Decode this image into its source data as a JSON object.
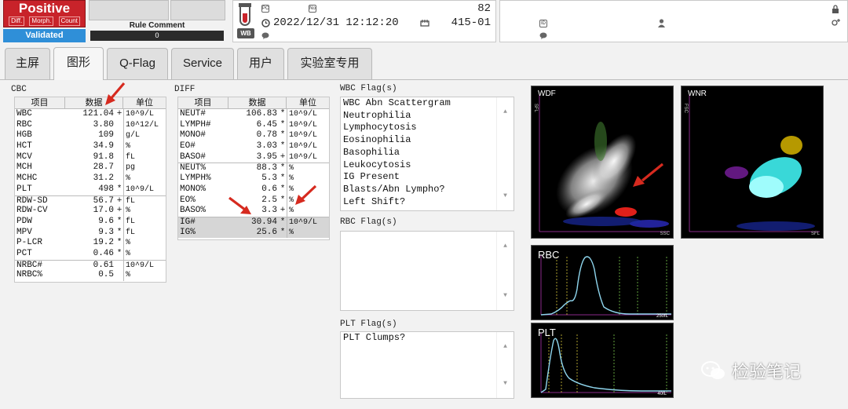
{
  "status": {
    "result": "Positive",
    "sub_flags": [
      "Diff.",
      "Morph.",
      "Count"
    ],
    "validated": "Validated",
    "rule_comment_label": "Rule Comment",
    "rule_comment_value": "0"
  },
  "sample": {
    "tube_type": "WB",
    "pc_icon_label": "PC",
    "no_icon_label": "No",
    "number": "82",
    "datetime": "2022/12/31 12:12:20",
    "rack_position": "415-01"
  },
  "patient": {
    "id_icon_label": "ID"
  },
  "tabs": [
    {
      "label": "主屏",
      "active": false
    },
    {
      "label": "图形",
      "active": true
    },
    {
      "label": "Q-Flag",
      "active": false
    },
    {
      "label": "Service",
      "active": false
    },
    {
      "label": "用户",
      "active": false
    },
    {
      "label": "实验室专用",
      "active": false
    }
  ],
  "cbc": {
    "title": "CBC",
    "headers": [
      "项目",
      "数据",
      "单位"
    ],
    "rows": [
      {
        "name": "WBC",
        "value": "121.04",
        "flag": "+",
        "unit": "10^9/L",
        "sep": false
      },
      {
        "name": "RBC",
        "value": "3.80",
        "flag": "",
        "unit": "10^12/L",
        "sep": false
      },
      {
        "name": "HGB",
        "value": "109",
        "flag": "",
        "unit": "g/L",
        "sep": false
      },
      {
        "name": "HCT",
        "value": "34.9",
        "flag": "",
        "unit": "%",
        "sep": false
      },
      {
        "name": "MCV",
        "value": "91.8",
        "flag": "",
        "unit": "fL",
        "sep": false
      },
      {
        "name": "MCH",
        "value": "28.7",
        "flag": "",
        "unit": "pg",
        "sep": false
      },
      {
        "name": "MCHC",
        "value": "31.2",
        "flag": "",
        "unit": "%",
        "sep": false
      },
      {
        "name": "PLT",
        "value": "498",
        "flag": "*",
        "unit": "10^9/L",
        "sep": false
      },
      {
        "name": "RDW-SD",
        "value": "56.7",
        "flag": "+",
        "unit": "fL",
        "sep": true
      },
      {
        "name": "RDW-CV",
        "value": "17.0",
        "flag": "+",
        "unit": "%",
        "sep": false
      },
      {
        "name": "PDW",
        "value": "9.6",
        "flag": "*",
        "unit": "fL",
        "sep": false
      },
      {
        "name": "MPV",
        "value": "9.3",
        "flag": "*",
        "unit": "fL",
        "sep": false
      },
      {
        "name": "P-LCR",
        "value": "19.2",
        "flag": "*",
        "unit": "%",
        "sep": false
      },
      {
        "name": "PCT",
        "value": "0.46",
        "flag": "*",
        "unit": "%",
        "sep": false
      },
      {
        "name": "NRBC#",
        "value": "0.61",
        "flag": "",
        "unit": "10^9/L",
        "sep": true
      },
      {
        "name": "NRBC%",
        "value": "0.5",
        "flag": "",
        "unit": "%",
        "sep": false
      }
    ]
  },
  "diff": {
    "title": "DIFF",
    "headers": [
      "项目",
      "数据",
      "单位"
    ],
    "rows": [
      {
        "name": "NEUT#",
        "value": "106.83",
        "flag": "*",
        "unit": "10^9/L",
        "sep": false,
        "hl": false
      },
      {
        "name": "LYMPH#",
        "value": "6.45",
        "flag": "*",
        "unit": "10^9/L",
        "sep": false,
        "hl": false
      },
      {
        "name": "MONO#",
        "value": "0.78",
        "flag": "*",
        "unit": "10^9/L",
        "sep": false,
        "hl": false
      },
      {
        "name": "EO#",
        "value": "3.03",
        "flag": "*",
        "unit": "10^9/L",
        "sep": false,
        "hl": false
      },
      {
        "name": "BASO#",
        "value": "3.95",
        "flag": "+",
        "unit": "10^9/L",
        "sep": false,
        "hl": false
      },
      {
        "name": "NEUT%",
        "value": "88.3",
        "flag": "*",
        "unit": "%",
        "sep": true,
        "hl": false
      },
      {
        "name": "LYMPH%",
        "value": "5.3",
        "flag": "*",
        "unit": "%",
        "sep": false,
        "hl": false
      },
      {
        "name": "MONO%",
        "value": "0.6",
        "flag": "*",
        "unit": "%",
        "sep": false,
        "hl": false
      },
      {
        "name": "EO%",
        "value": "2.5",
        "flag": "*",
        "unit": "%",
        "sep": false,
        "hl": false
      },
      {
        "name": "BASO%",
        "value": "3.3",
        "flag": "+",
        "unit": "%",
        "sep": false,
        "hl": false
      },
      {
        "name": "IG#",
        "value": "30.94",
        "flag": "*",
        "unit": "10^9/L",
        "sep": true,
        "hl": true
      },
      {
        "name": "IG%",
        "value": "25.6",
        "flag": "*",
        "unit": "%",
        "sep": false,
        "hl": true
      }
    ]
  },
  "wbc_flags": {
    "title": "WBC Flag(s)",
    "items": [
      "WBC Abn Scattergram",
      "Neutrophilia",
      "Lymphocytosis",
      "Eosinophilia",
      "Basophilia",
      "Leukocytosis",
      "IG Present",
      "Blasts/Abn Lympho?",
      "Left Shift?"
    ]
  },
  "rbc_flags": {
    "title": "RBC Flag(s)",
    "items": []
  },
  "plt_flags": {
    "title": "PLT Flag(s)",
    "items": [
      "PLT Clumps?"
    ]
  },
  "plots": {
    "wdf": {
      "label": "WDF",
      "y_axis": "SFL",
      "x_axis": "SSC"
    },
    "wnr": {
      "label": "WNR",
      "y_axis": "FSC",
      "x_axis": "SFL"
    },
    "rbc": {
      "label": "RBC",
      "x_max": "250fL"
    },
    "plt": {
      "label": "PLT",
      "x_max": "40fL"
    }
  },
  "watermark": "检验笔记",
  "colors": {
    "positive": "#c8232a",
    "validated": "#2f8fd8",
    "annotation_arrow": "#d62a1f",
    "curve": "#8fd6ee"
  }
}
